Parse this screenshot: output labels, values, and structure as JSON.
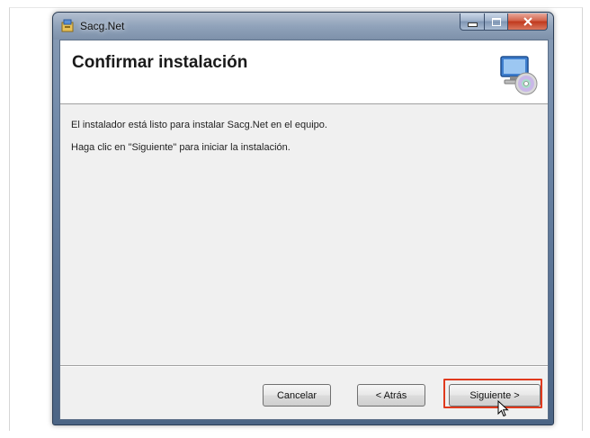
{
  "window": {
    "title": "Sacg.Net"
  },
  "banner": {
    "title": "Confirmar instalación"
  },
  "body": {
    "line1": "El instalador está listo para instalar Sacg.Net en el equipo.",
    "line2": "Haga clic en \"Siguiente\" para iniciar la instalación."
  },
  "buttons": {
    "cancel": "Cancelar",
    "back": "< Atrás",
    "next": "Siguiente >"
  },
  "icons": {
    "app": "installer-package-icon",
    "banner": "computer-cd-icon",
    "cursor": "mouse-pointer-icon"
  },
  "colors": {
    "highlight": "#e03a1e"
  }
}
